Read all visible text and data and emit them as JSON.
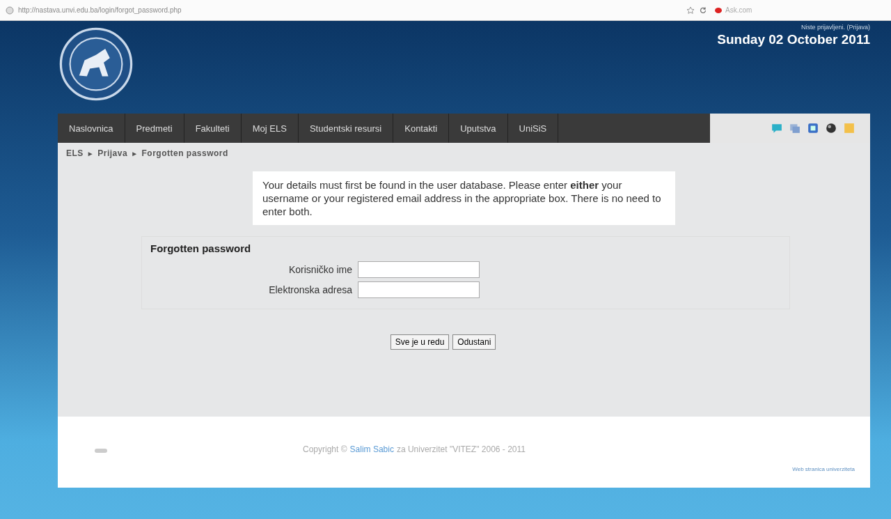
{
  "browser": {
    "url": "http://nastava.unvi.edu.ba/login/forgot_password.php",
    "search_placeholder": "Ask.com"
  },
  "header": {
    "login_status": "Niste prijavljeni. (Prijava)",
    "date": "Sunday 02 October 2011"
  },
  "nav": {
    "items": [
      {
        "label": "Naslovnica"
      },
      {
        "label": "Predmeti"
      },
      {
        "label": "Fakulteti"
      },
      {
        "label": "Moj ELS"
      },
      {
        "label": "Studentski resursi"
      },
      {
        "label": "Kontakti"
      },
      {
        "label": "Uputstva"
      },
      {
        "label": "UniSiS"
      }
    ]
  },
  "breadcrumb": {
    "separator": "►",
    "items": [
      "ELS",
      "Prijava",
      "Forgotten password"
    ]
  },
  "info": "Your details must first be found in the user database. Please enter **either** your username or your registered email address in the appropriate box. There is no need to enter both.",
  "form": {
    "legend": "Forgotten password",
    "fields": [
      {
        "label": "Korisničko ime"
      },
      {
        "label": "Elektronska adresa"
      }
    ],
    "buttons": [
      "Sve je u redu",
      "Odustani"
    ]
  },
  "footer": {
    "copyright_prefix": "Copyright ©",
    "author": "Salim Sabic",
    "copyright_suffix": "za Univerzitet \"VITEZ\" 2006 - 2011",
    "site_link": "Web stranica univerziteta"
  }
}
